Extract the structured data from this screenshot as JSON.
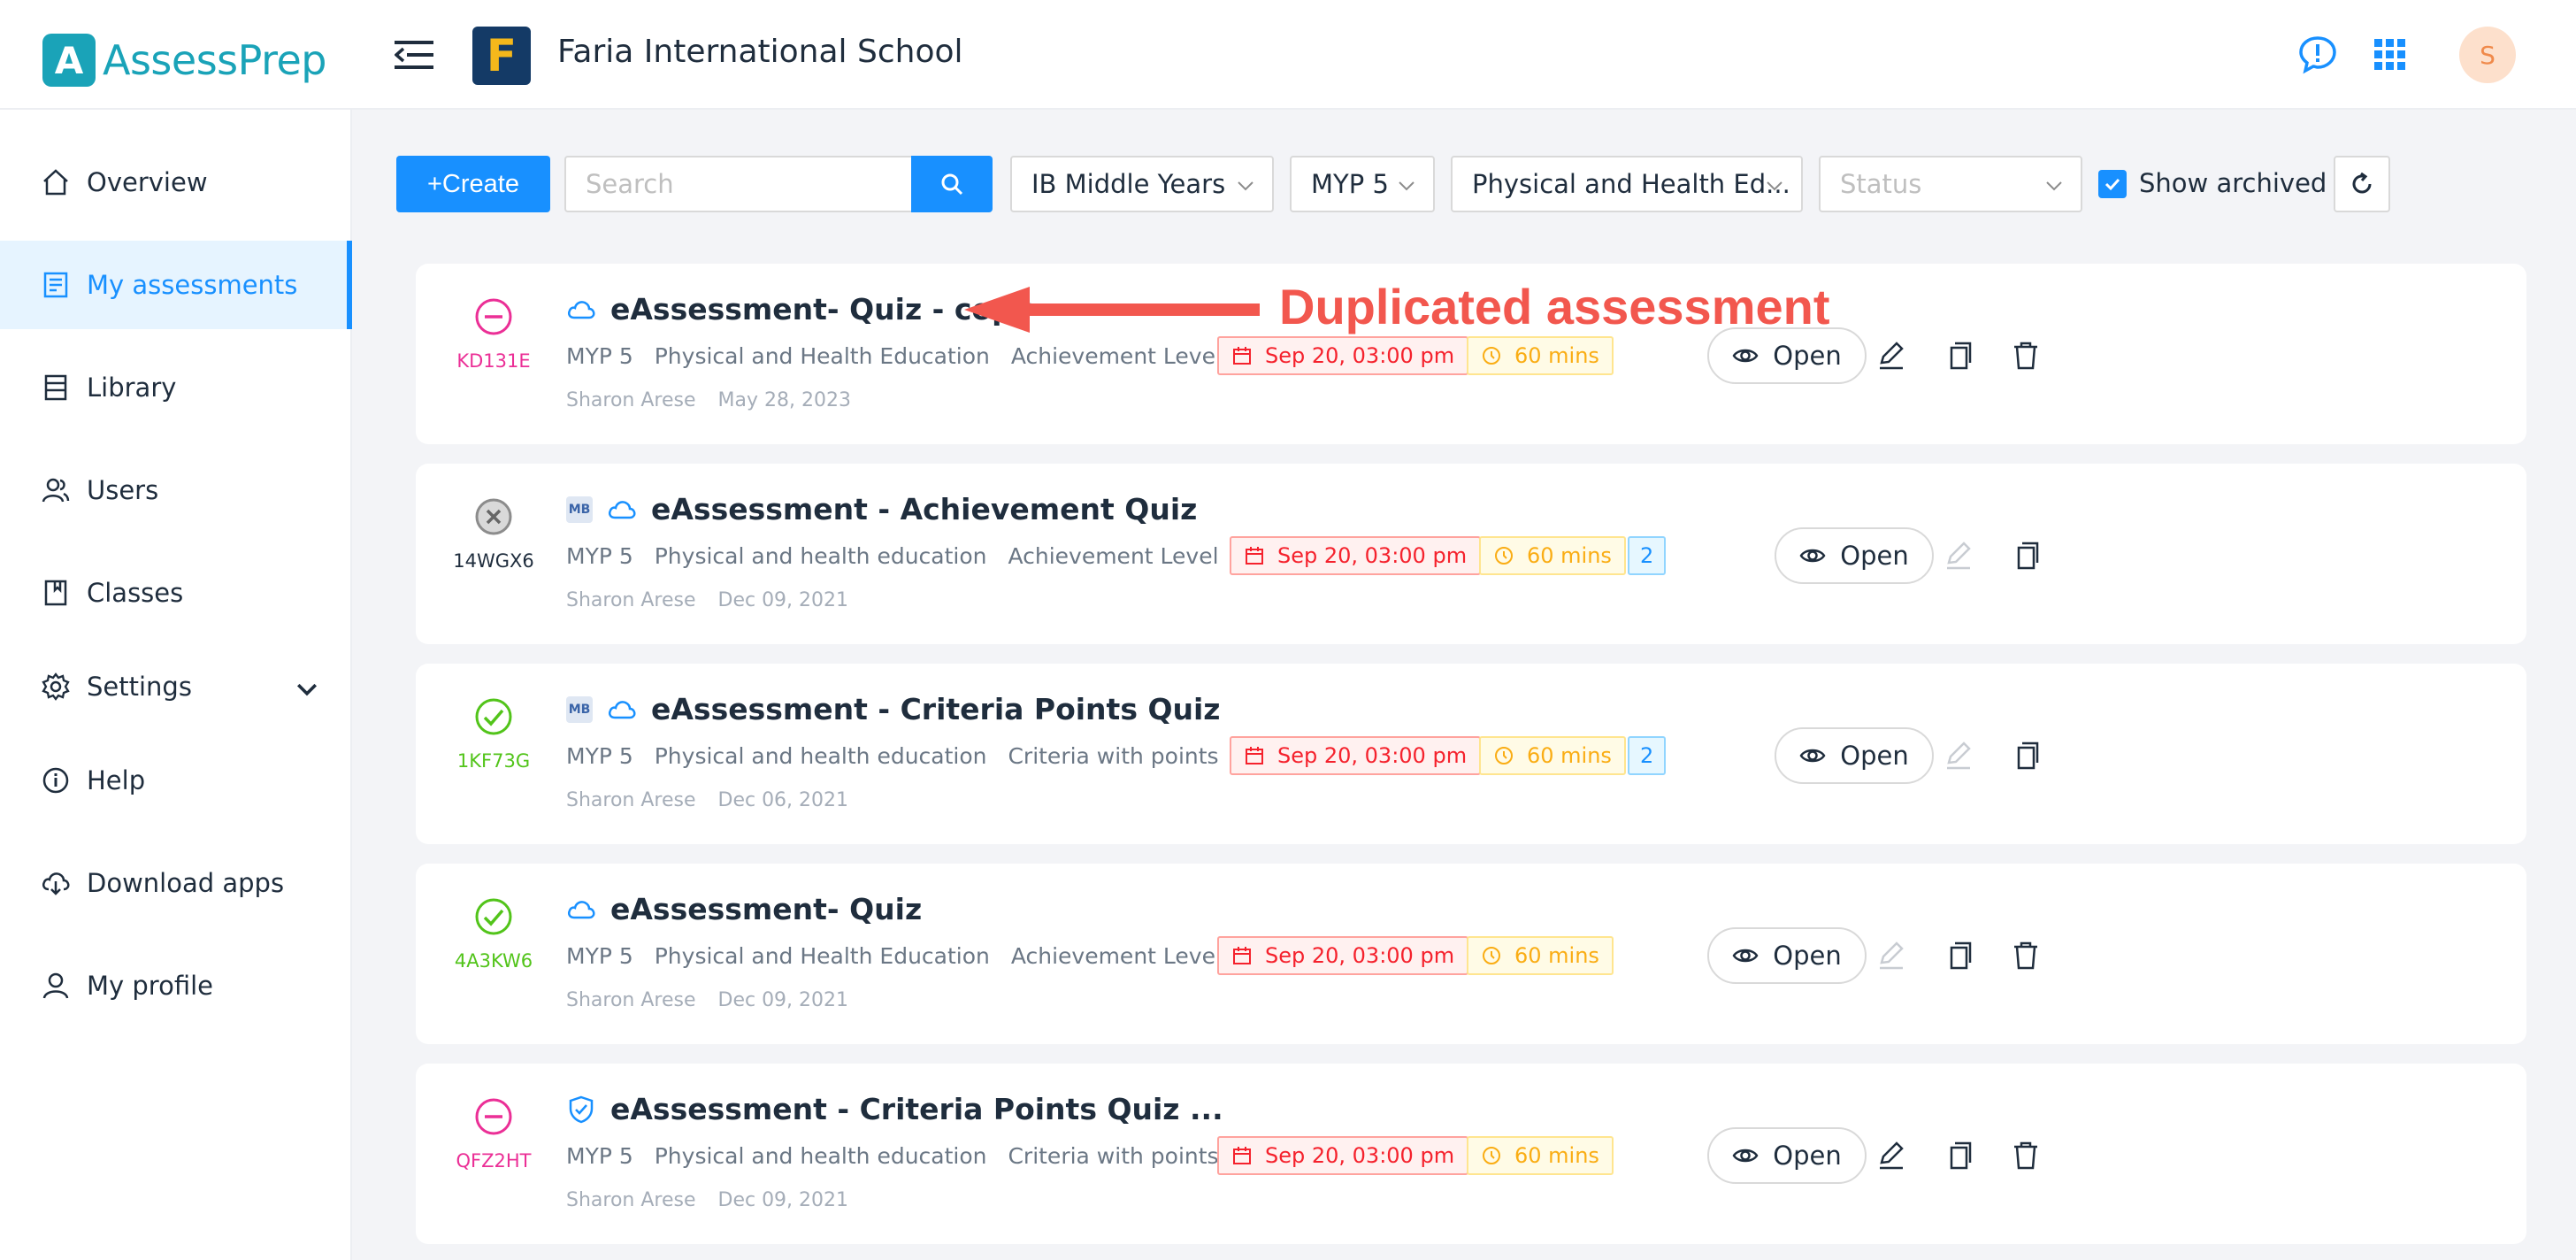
{
  "app": {
    "logo_letter": "A",
    "name": "AssessPrep"
  },
  "header": {
    "school_logo_letter": "F",
    "school_name": "Faria International School",
    "avatar_initial": "S"
  },
  "sidebar": {
    "items": [
      {
        "label": "Overview",
        "icon": "home-icon"
      },
      {
        "label": "My assessments",
        "icon": "assessments-icon",
        "active": true
      },
      {
        "label": "Library",
        "icon": "library-icon"
      },
      {
        "label": "Users",
        "icon": "users-icon"
      },
      {
        "label": "Classes",
        "icon": "classes-icon"
      },
      {
        "label": "Settings",
        "icon": "gear-icon"
      },
      {
        "label": "Help",
        "icon": "info-icon"
      },
      {
        "label": "Download apps",
        "icon": "cloud-download-icon"
      },
      {
        "label": "My profile",
        "icon": "user-icon"
      }
    ]
  },
  "toolbar": {
    "create_label": "+Create",
    "search_placeholder": "Search",
    "program": "IB Middle Years",
    "grade": "MYP 5",
    "subject": "Physical and Health Ed...",
    "status_placeholder": "Status",
    "show_archived_label": "Show archived",
    "show_archived_checked": true
  },
  "annotation": {
    "text": "Duplicated assessment",
    "color": "#f2574e"
  },
  "assessments": [
    {
      "status": "minus",
      "code": "KD131E",
      "title": "eAssessment- Quiz - copy",
      "grade": "MYP 5",
      "subject": "Physical and Health Education",
      "grading": "Achievement Level",
      "author": "Sharon Arese",
      "date": "May 28, 2023",
      "due": "Sep 20, 03:00 pm",
      "duration": "60 mins"
    },
    {
      "status": "cross",
      "code": "14WGX6",
      "title": "eAssessment - Achievement Quiz",
      "grade": "MYP 5",
      "subject": "Physical and health education",
      "grading": "Achievement Level",
      "author": "Sharon Arese",
      "date": "Dec 09, 2021",
      "due": "Sep 20, 03:00 pm",
      "duration": "60 mins",
      "count": "2"
    },
    {
      "status": "check",
      "code": "1KF73G",
      "title": "eAssessment - Criteria Points Quiz",
      "grade": "MYP 5",
      "subject": "Physical and health education",
      "grading": "Criteria with points",
      "author": "Sharon Arese",
      "date": "Dec 06, 2021",
      "due": "Sep 20, 03:00 pm",
      "duration": "60 mins",
      "count": "2"
    },
    {
      "status": "check",
      "code": "4A3KW6",
      "title": "eAssessment- Quiz",
      "grade": "MYP 5",
      "subject": "Physical and Health Education",
      "grading": "Achievement Level",
      "author": "Sharon Arese",
      "date": "Dec 09, 2021",
      "due": "Sep 20, 03:00 pm",
      "duration": "60 mins"
    },
    {
      "status": "minus",
      "code": "QFZ2HT",
      "title": "eAssessment - Criteria Points Quiz ...",
      "grade": "MYP 5",
      "subject": "Physical and health education",
      "grading": "Criteria with points",
      "author": "Sharon Arese",
      "date": "Dec 09, 2021",
      "due": "Sep 20, 03:00 pm",
      "duration": "60 mins"
    }
  ],
  "labels": {
    "open": "Open",
    "mb": "MB"
  },
  "colors": {
    "primary": "#1890ff",
    "brand": "#1aa3b8",
    "status_minus": "#eb2f96",
    "status_check": "#52c41a",
    "status_cross": "#8c8c8c"
  }
}
